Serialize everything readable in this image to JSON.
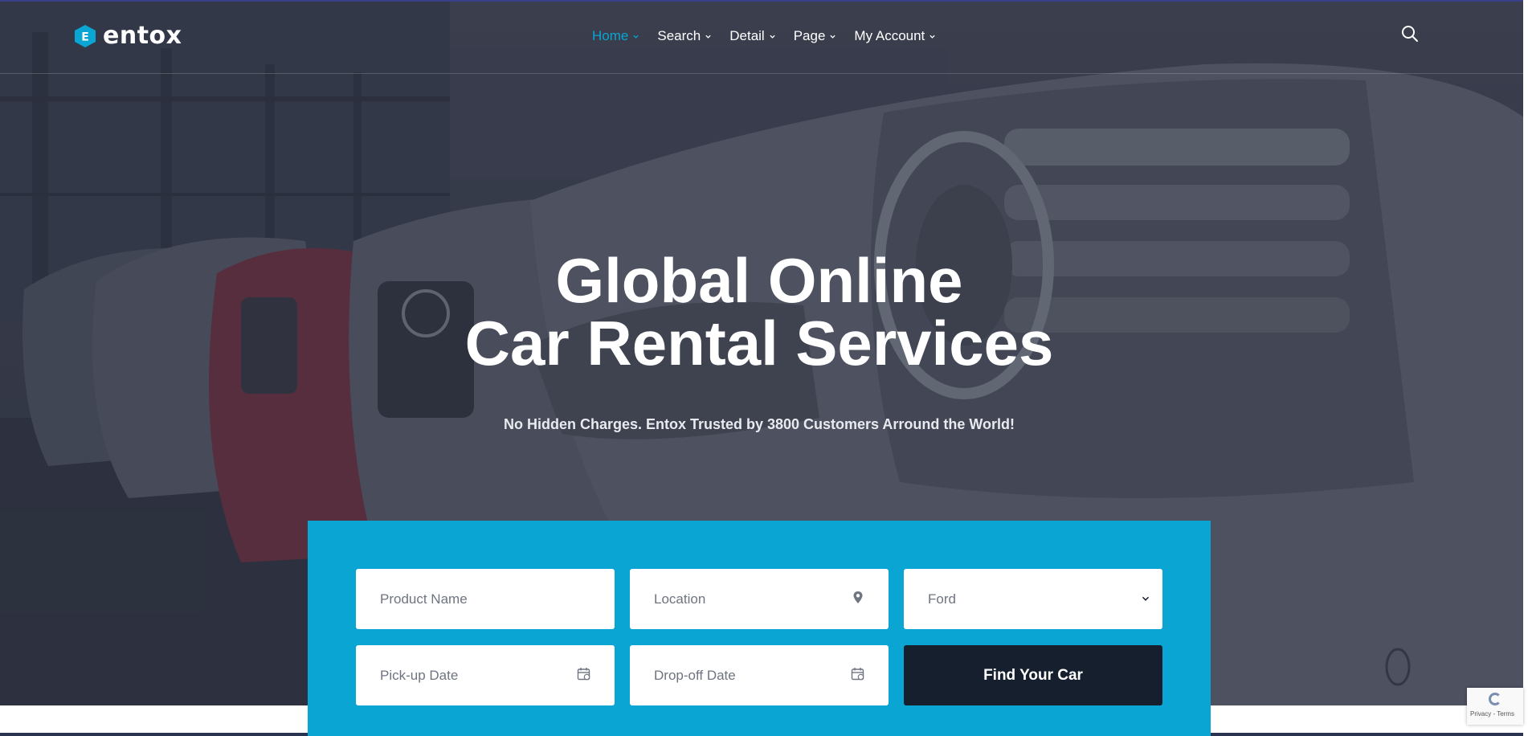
{
  "brand": {
    "name": "entox",
    "logo_letter": "E",
    "accent": "#0aa5d3"
  },
  "nav": {
    "items": [
      {
        "label": "Home",
        "active": true
      },
      {
        "label": "Search",
        "active": false
      },
      {
        "label": "Detail",
        "active": false
      },
      {
        "label": "Page",
        "active": false
      },
      {
        "label": "My Account",
        "active": false
      }
    ],
    "search_icon": "search-icon",
    "dropdown_icon": "chevron-down-icon"
  },
  "hero": {
    "title_line1": "Global Online",
    "title_line2": "Car Rental Services",
    "subtitle": "No Hidden Charges. Entox Trusted by 3800 Customers Arround the World!"
  },
  "search_form": {
    "product_name_placeholder": "Product Name",
    "location_placeholder": "Location",
    "brand_selected": "Ford",
    "pickup_placeholder": "Pick-up Date",
    "dropoff_placeholder": "Drop-off Date",
    "submit_label": "Find Your Car",
    "panel_color": "#0aa5d3",
    "button_color": "#151f2e"
  },
  "recaptcha": {
    "terms_text": "Privacy - Terms"
  }
}
